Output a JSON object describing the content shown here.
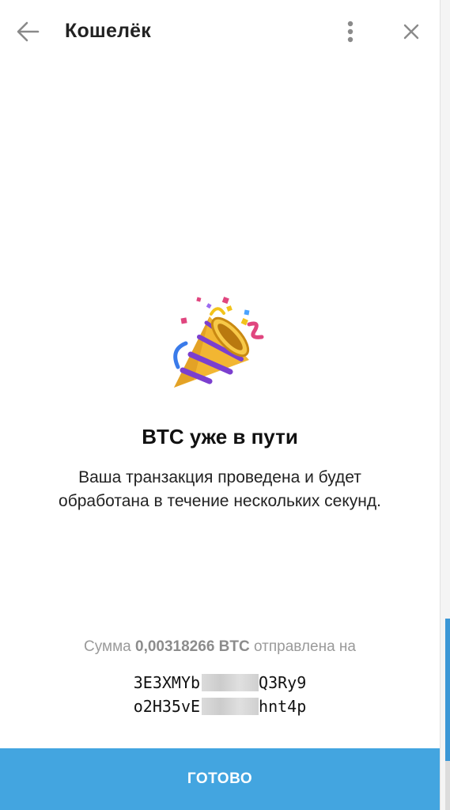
{
  "header": {
    "title": "Кошелёк",
    "back_icon": "arrow-left-icon",
    "menu_icon": "more-vertical-icon",
    "close_icon": "close-icon"
  },
  "content": {
    "icon": "party-popper-icon",
    "headline": "BTC уже в пути",
    "description": "Ваша транзакция проведена и будет обработана в течение нескольких секунд.",
    "amount_prefix": "Сумма",
    "amount_value": "0,00318266 BTC",
    "amount_suffix": "отправлена на",
    "address_line1_start": "3E3XMYb",
    "address_line1_end": "Q3Ry9",
    "address_line2_start": "o2H35vE",
    "address_line2_end": "hnt4p"
  },
  "footer": {
    "done_label": "ГОТОВО"
  },
  "colors": {
    "accent": "#43a5e0",
    "muted_text": "#9a9a9a"
  }
}
